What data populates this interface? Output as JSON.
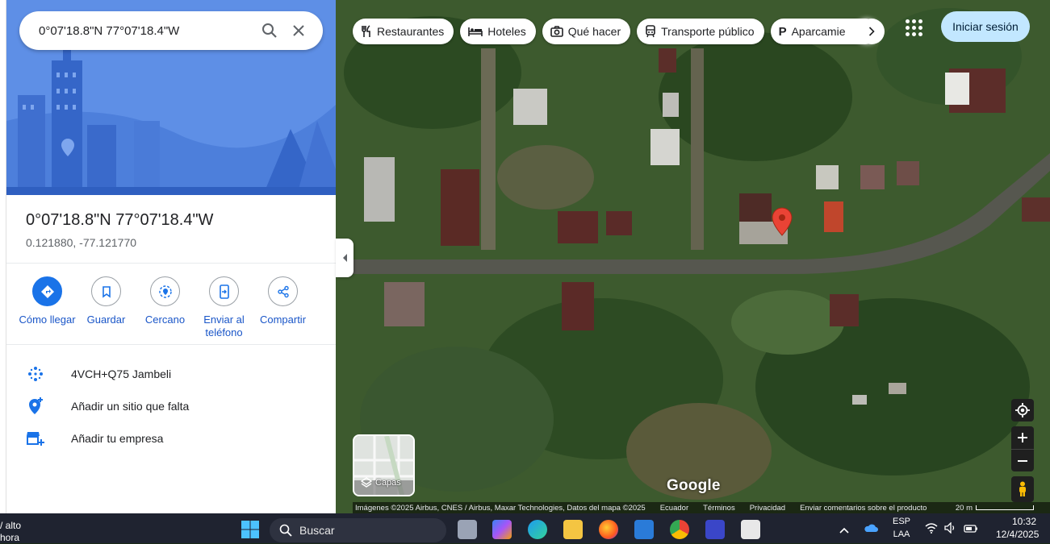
{
  "search": {
    "query": "0°07'18.8\"N 77°07'18.4\"W"
  },
  "place": {
    "title": "0°07'18.8\"N 77°07'18.4\"W",
    "decimal_coords": "0.121880, -77.121770"
  },
  "actions": [
    {
      "label": "Cómo llegar",
      "icon": "directions-icon"
    },
    {
      "label": "Guardar",
      "icon": "bookmark-icon"
    },
    {
      "label": "Cercano",
      "icon": "nearby-icon"
    },
    {
      "label": "Enviar al teléfono",
      "icon": "send-to-phone-icon"
    },
    {
      "label": "Compartir",
      "icon": "share-icon"
    }
  ],
  "info_rows": [
    {
      "text": "4VCH+Q75 Jambeli",
      "icon": "plus-code-icon"
    },
    {
      "text": "Añadir un sitio que falta",
      "icon": "add-place-icon"
    },
    {
      "text": "Añadir tu empresa",
      "icon": "add-business-icon"
    }
  ],
  "chips": [
    {
      "label": "Restaurantes",
      "icon": "restaurant-icon"
    },
    {
      "label": "Hoteles",
      "icon": "hotel-icon"
    },
    {
      "label": "Qué hacer",
      "icon": "camera-icon"
    },
    {
      "label": "Transporte público",
      "icon": "transit-icon"
    },
    {
      "label": "Aparcamie",
      "icon": "parking-icon"
    }
  ],
  "signin": "Iniciar sesión",
  "layers_label": "Capas",
  "google_logo": "Google",
  "attribution": {
    "imagery": "Imágenes ©2025 Airbus, CNES / Airbus, Maxar Technologies, Datos del mapa ©2025",
    "country": "Ecuador",
    "terms": "Términos",
    "privacy": "Privacidad",
    "feedback": "Enviar comentarios sobre el producto",
    "scale": "20 m"
  },
  "taskbar": {
    "weather_line1": "/ alto",
    "weather_line2": "hora",
    "search_placeholder": "Buscar",
    "lang_line1": "ESP",
    "lang_line2": "LAA",
    "time": "10:32",
    "date": "12/4/2025"
  },
  "colors": {
    "accent": "#1a73e8",
    "pin": "#ea4335",
    "signin_bg": "#c2e7ff"
  }
}
